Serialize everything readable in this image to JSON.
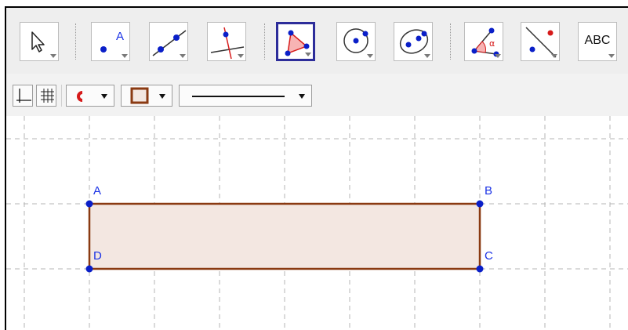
{
  "toolbar": {
    "tools": [
      {
        "name": "move-tool",
        "icon": "cursor-arrow-icon",
        "selected": false
      },
      {
        "name": "point-tool",
        "icon": "point-icon",
        "label": "A",
        "selected": false
      },
      {
        "name": "line-tool",
        "icon": "line-through-two-points-icon",
        "selected": false
      },
      {
        "name": "perpendicular-line-tool",
        "icon": "perpendicular-line-icon",
        "selected": false
      },
      {
        "name": "polygon-tool",
        "icon": "polygon-icon",
        "selected": true
      },
      {
        "name": "circle-tool",
        "icon": "circle-center-point-icon",
        "selected": false
      },
      {
        "name": "ellipse-tool",
        "icon": "ellipse-icon",
        "selected": false
      },
      {
        "name": "angle-tool",
        "icon": "angle-icon",
        "label": "α",
        "selected": false
      },
      {
        "name": "reflect-tool",
        "icon": "reflect-about-line-icon",
        "selected": false
      },
      {
        "name": "text-tool",
        "icon": "text-icon",
        "label": "ABC",
        "selected": false
      }
    ]
  },
  "stylebar": {
    "items": [
      {
        "name": "axes-toggle",
        "icon": "axes-icon"
      },
      {
        "name": "grid-toggle",
        "icon": "grid-icon"
      },
      {
        "name": "color-dropdown",
        "icon": "color-icon"
      },
      {
        "name": "fill-style-dropdown",
        "icon": "fill-style-icon"
      },
      {
        "name": "line-style-dropdown",
        "icon": "line-style-icon"
      }
    ]
  },
  "colors": {
    "selected_border": "#2d2d9a",
    "point_blue": "#0a1fc8",
    "label_blue": "#1a32e6",
    "polygon_stroke": "#8a3a12",
    "polygon_fill": "#f3e7e1",
    "accent_red": "#d61a1a",
    "grid_line": "#b4b4b4"
  },
  "canvas": {
    "points": [
      {
        "label": "A"
      },
      {
        "label": "B"
      },
      {
        "label": "C"
      },
      {
        "label": "D"
      }
    ]
  }
}
